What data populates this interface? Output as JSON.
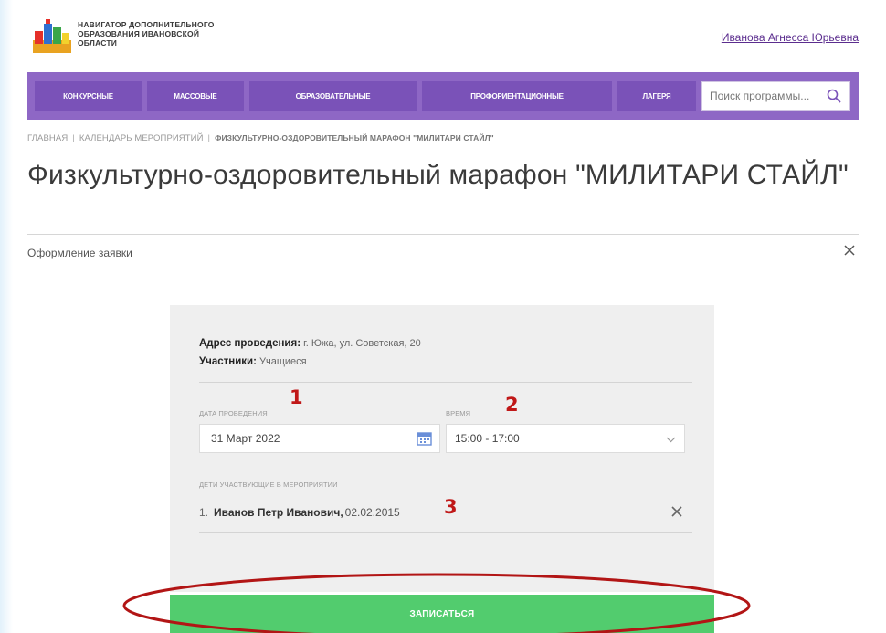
{
  "header": {
    "logo_text_line1": "НАВИГАТОР ДОПОЛНИТЕЛЬНОГО",
    "logo_text_line2": "ОБРАЗОВАНИЯ ИВАНОВСКОЙ",
    "logo_text_line3": "ОБЛАСТИ",
    "user_name": "Иванова Агнесса Юрьевна"
  },
  "nav": {
    "items": [
      {
        "label": "КОНКУРСНЫЕ"
      },
      {
        "label": "МАССОВЫЕ"
      },
      {
        "label": "ОБРАЗОВАТЕЛЬНЫЕ"
      },
      {
        "label": "ПРОФОРИЕНТАЦИОННЫЕ"
      },
      {
        "label": "ЛАГЕРЯ"
      }
    ],
    "search_placeholder": "Поиск программы..."
  },
  "breadcrumb": {
    "home": "ГЛАВНАЯ",
    "calendar": "КАЛЕНДАРЬ МЕРОПРИЯТИЙ",
    "current": "ФИЗКУЛЬТУРНО-ОЗДОРОВИТЕЛЬНЫЙ МАРАФОН \"МИЛИТАРИ СТАЙЛ\""
  },
  "page": {
    "title": "Физкультурно-оздоровительный марафон \"МИЛИТАРИ СТАЙЛ\"",
    "form_heading": "Оформление заявки"
  },
  "form": {
    "address_label": "Адрес проведения:",
    "address_value": " г. Южа, ул. Советская, 20",
    "participants_label": "Участники:",
    "participants_value": " Учащиеся",
    "date_label": "ДАТА ПРОВЕДЕНИЯ",
    "date_value": "31 Март 2022",
    "time_label": "ВРЕМЯ",
    "time_value": "15:00 - 17:00",
    "children_label": "ДЕТИ УЧАСТВУЮЩИЕ В МЕРОПРИЯТИИ",
    "children": [
      {
        "num": "1.",
        "name": "Иванов Петр Иванович,",
        "dob": " 02.02.2015"
      }
    ],
    "submit_label": "ЗАПИСАТЬСЯ"
  },
  "annotations": {
    "one": "1",
    "two": "2",
    "three": "3"
  },
  "colors": {
    "nav_bg": "#8e67c5",
    "nav_item_bg": "#7a52b8",
    "user_link": "#5b2d8e",
    "submit_bg": "#52cc6e",
    "annotation_red": "#c01818"
  }
}
